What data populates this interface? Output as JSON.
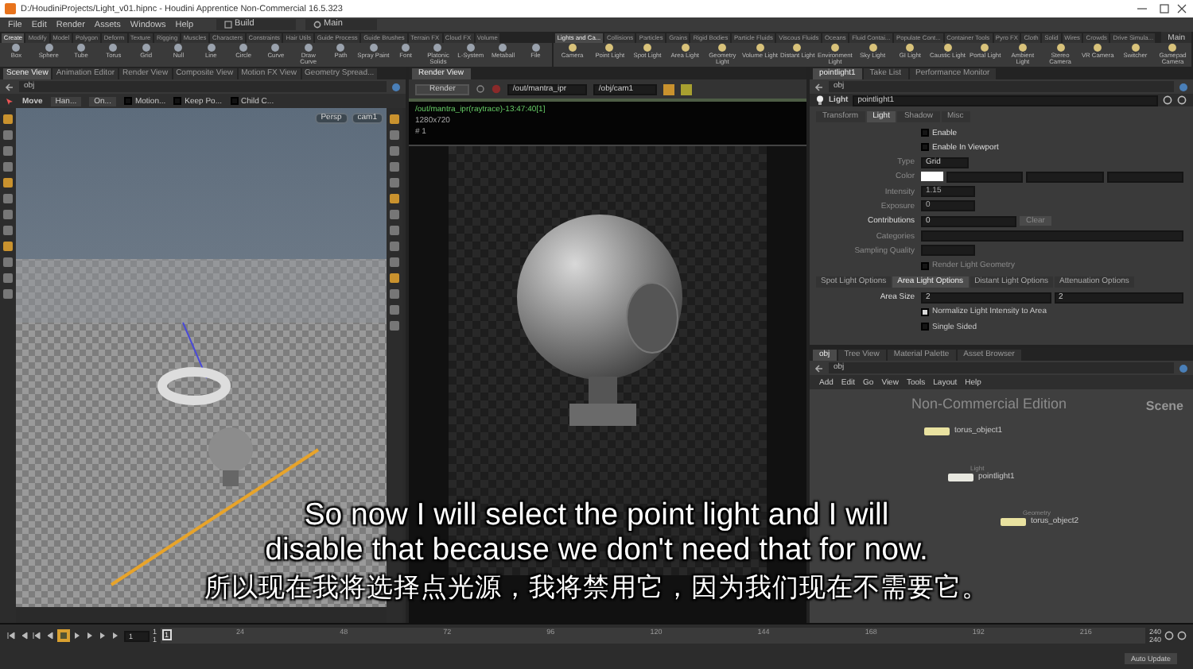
{
  "window": {
    "title": "D:/HoudiniProjects/Light_v01.hipnc - Houdini Apprentice Non-Commercial 16.5.323"
  },
  "menu_bar": {
    "items": [
      "File",
      "Edit",
      "Render",
      "Assets",
      "Windows",
      "Help"
    ],
    "desktop": "Build",
    "workspace": "Main"
  },
  "shelf_sets": [
    {
      "tabs": [
        {
          "label": "Create",
          "selected": true
        },
        {
          "label": "Modify",
          "selected": false
        },
        {
          "label": "Model",
          "selected": false
        },
        {
          "label": "Polygon",
          "selected": false
        },
        {
          "label": "Deform",
          "selected": false
        },
        {
          "label": "Texture",
          "selected": false
        },
        {
          "label": "Rigging",
          "selected": false
        },
        {
          "label": "Muscles",
          "selected": false
        },
        {
          "label": "Characters",
          "selected": false
        },
        {
          "label": "Constraints",
          "selected": false
        },
        {
          "label": "Hair Utils",
          "selected": false
        },
        {
          "label": "Guide Process",
          "selected": false
        },
        {
          "label": "Guide Brushes",
          "selected": false
        },
        {
          "label": "Terrain FX",
          "selected": false
        },
        {
          "label": "Cloud FX",
          "selected": false
        },
        {
          "label": "Volume",
          "selected": false
        }
      ],
      "tools": [
        "Box",
        "Sphere",
        "Tube",
        "Torus",
        "Grid",
        "Null",
        "Line",
        "Circle",
        "Curve",
        "Draw Curve",
        "Path",
        "Spray Paint",
        "Font",
        "Platonic Solids",
        "L-System",
        "Metaball",
        "File"
      ]
    },
    {
      "workspace": "Main",
      "tabs": [
        {
          "label": "Lights and Ca...",
          "selected": true
        },
        {
          "label": "Collisions",
          "selected": false
        },
        {
          "label": "Particles",
          "selected": false
        },
        {
          "label": "Grains",
          "selected": false
        },
        {
          "label": "Rigid Bodies",
          "selected": false
        },
        {
          "label": "Particle Fluids",
          "selected": false
        },
        {
          "label": "Viscous Fluids",
          "selected": false
        },
        {
          "label": "Oceans",
          "selected": false
        },
        {
          "label": "Fluid Contai...",
          "selected": false
        },
        {
          "label": "Populate Cont...",
          "selected": false
        },
        {
          "label": "Container Tools",
          "selected": false
        },
        {
          "label": "Pyro FX",
          "selected": false
        },
        {
          "label": "Cloth",
          "selected": false
        },
        {
          "label": "Solid",
          "selected": false
        },
        {
          "label": "Wires",
          "selected": false
        },
        {
          "label": "Crowds",
          "selected": false
        },
        {
          "label": "Drive Simula...",
          "selected": false
        }
      ],
      "tools": [
        "Camera",
        "Point Light",
        "Spot Light",
        "Area Light",
        "Geometry Light",
        "Volume Light",
        "Distant Light",
        "Environment Light",
        "Sky Light",
        "GI Light",
        "Caustic Light",
        "Portal Light",
        "Ambient Light",
        "Stereo Camera",
        "VR Camera",
        "Switcher",
        "Gamepad Camera"
      ]
    }
  ],
  "scene_view": {
    "tabs": [
      {
        "label": "Scene View",
        "selected": true
      },
      {
        "label": "Animation Editor",
        "selected": false
      },
      {
        "label": "Render View",
        "selected": false
      },
      {
        "label": "Composite View",
        "selected": false
      },
      {
        "label": "Motion FX View",
        "selected": false
      },
      {
        "label": "Geometry Spread...",
        "selected": false
      }
    ],
    "path": "obj",
    "toolbar": [
      {
        "kind": "tool",
        "label": "Move"
      },
      {
        "kind": "menu",
        "label": "Han..."
      },
      {
        "kind": "menu",
        "label": "On..."
      },
      {
        "kind": "check",
        "label": "Motion...",
        "checked": false
      },
      {
        "kind": "check",
        "label": "Keep Po...",
        "checked": false
      },
      {
        "kind": "check",
        "label": "Child C...",
        "checked": false
      }
    ],
    "view": "Persp",
    "camera": "cam1"
  },
  "render_view": {
    "tabs": [
      {
        "label": "Render View",
        "selected": true
      }
    ],
    "button": "Render",
    "renderer": "/out/mantra_ipr",
    "camera": "/obj/cam1",
    "log": [
      "/out/mantra_ipr(raytrace)-13:47:40[1]",
      "1280x720",
      "# 1"
    ]
  },
  "parameters": {
    "tabs": [
      {
        "label": "pointlight1",
        "selected": true
      },
      {
        "label": "Take List",
        "selected": false
      },
      {
        "label": "Performance Monitor",
        "selected": false
      }
    ],
    "path": "obj",
    "node_type": "Light",
    "node_name": "pointlight1",
    "page_tabs": [
      {
        "label": "Transform",
        "selected": false
      },
      {
        "label": "Light",
        "selected": true
      },
      {
        "label": "Shadow",
        "selected": false
      },
      {
        "label": "Misc",
        "selected": false
      }
    ],
    "fields": [
      {
        "kind": "check",
        "label": "Enable",
        "checked": false,
        "disabled": false
      },
      {
        "kind": "check",
        "label": "Enable In Viewport",
        "checked": false,
        "disabled": false
      },
      {
        "kind": "menu",
        "label": "Type",
        "value": "Grid",
        "disabled": true
      },
      {
        "kind": "color",
        "label": "Color",
        "disabled": true
      },
      {
        "kind": "number",
        "label": "Intensity",
        "value": "1.15",
        "disabled": true
      },
      {
        "kind": "number",
        "label": "Exposure",
        "value": "0",
        "disabled": true
      },
      {
        "kind": "contrib",
        "label": "Contributions",
        "value": "0",
        "button": "Clear",
        "disabled": false
      },
      {
        "kind": "text",
        "label": "Categories",
        "disabled": true
      },
      {
        "kind": "number",
        "label": "Sampling Quality",
        "disabled": true
      },
      {
        "kind": "check",
        "label": "Render Light Geometry",
        "checked": false,
        "disabled": true
      }
    ],
    "option_tabs": [
      {
        "label": "Spot Light Options",
        "selected": false
      },
      {
        "label": "Area Light Options",
        "selected": true
      },
      {
        "label": "Distant Light Options",
        "selected": false
      },
      {
        "label": "Attenuation Options",
        "selected": false
      }
    ],
    "area_size": {
      "label": "Area Size",
      "values": [
        "2",
        "2"
      ]
    },
    "options": [
      {
        "label": "Normalize Light Intensity to Area",
        "checked": true
      },
      {
        "label": "Single Sided",
        "checked": false
      }
    ]
  },
  "network": {
    "tabs": [
      {
        "label": "obj",
        "selected": true
      },
      {
        "label": "Tree View",
        "selected": false
      },
      {
        "label": "Material Palette",
        "selected": false
      },
      {
        "label": "Asset Browser",
        "selected": false
      }
    ],
    "path": "obj",
    "menu": [
      "Add",
      "Edit",
      "Go",
      "View",
      "Tools",
      "Layout",
      "Help"
    ],
    "edition": "Non-Commercial Edition",
    "context": "Scene",
    "nodes": [
      {
        "kind": "geometry",
        "name": "torus_object1"
      },
      {
        "kind": "light",
        "type": "Light",
        "name": "pointlight1"
      },
      {
        "kind": "geometry",
        "type": "Geometry",
        "name": "torus_object2"
      }
    ]
  },
  "timeline": {
    "frame": "1",
    "start": [
      "1",
      "1"
    ],
    "marker": "1",
    "ticks": [
      "24",
      "48",
      "72",
      "96",
      "120",
      "144",
      "168",
      "192",
      "216"
    ],
    "end": [
      "240",
      "240"
    ],
    "auto_update": "Auto Update"
  },
  "subtitles": [
    "So now I will select the point light and I will",
    "disable that because we don't need that for now.",
    "所以现在我将选择点光源，我将禁用它，因为我们现在不需要它。"
  ]
}
